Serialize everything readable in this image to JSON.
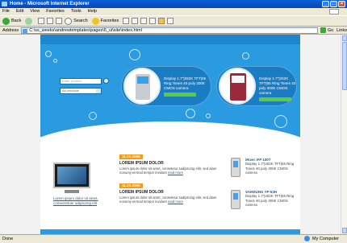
{
  "window": {
    "title": "Home - Microsoft Internet Explorer",
    "controls": [
      "_",
      "□",
      "×"
    ]
  },
  "menu": [
    "File",
    "Edit",
    "View",
    "Favorites",
    "Tools",
    "Help"
  ],
  "toolbar": {
    "back": "Back",
    "search": "Search",
    "favorites": "Favorites"
  },
  "address": {
    "label": "Address",
    "url": "C:\\ss_weeks\\andrewtemplates\\pages\\6_ui\\site\\index.html",
    "go": "Go",
    "links": "Links"
  },
  "site": {
    "search_placeholder": "Enter product",
    "select_value": "All products",
    "products": [
      {
        "desc": "Display 1.7\"|262K TFT|65 Ring Tones 40 poly 300K CMOS camera"
      },
      {
        "desc": "Display 1.7\"|262K TFT|65 Ring Tones 40 poly 300K CMOS camera"
      }
    ],
    "tv_caption": "Lorem ipsum dolor sit amet, consectetuer adipiscing elit",
    "news": [
      {
        "date": "11.03.2005",
        "head": "LOREM IPSUM DOLOR",
        "body": "Lorem ipsum dolor sit amet, consetetur sadipscing elitr, sed diam nonumy eirmod tempor invidunt",
        "more": "read more"
      },
      {
        "date": "11.03.2005",
        "head": "LOREM IPSUM DOLOR",
        "body": "Lorem ipsum dolor sit amet, consetetur sadipscing elitr, sed diam nonumy eirmod tempor invidunt",
        "more": "read more"
      }
    ],
    "side_products": [
      {
        "name": "iRiver iFP 100T",
        "desc": "Display 1.7\"|262K TFT|65 Ring Tones 40 poly 300K CMOS camera"
      },
      {
        "name": "SAMSUNG YP-53H",
        "desc": "Display 1.7\"|262K TFT|65 Ring Tones 40 poly 300K CMOS camera"
      }
    ]
  },
  "status": {
    "left": "Done",
    "zone": "My Computer"
  },
  "colors": {
    "hero": "#2a9be0",
    "date_badge": "#f29a1a",
    "go_button": "#5ecb3c"
  }
}
